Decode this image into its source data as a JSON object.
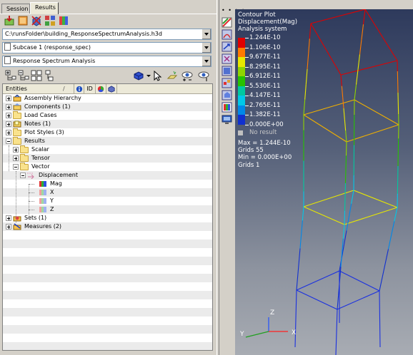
{
  "tabs": [
    {
      "label": "Session",
      "active": false
    },
    {
      "label": "Results",
      "active": true
    }
  ],
  "toolbar1_icons": [
    "load-model-icon",
    "load-results-icon",
    "delete-icon",
    "assembly-icon",
    "multi-results-icon"
  ],
  "file_path": "C:\\runsFolder\\building_ResponseSpectrumAnalysis.h3d",
  "subcase": "Subcase 1 (response_spec)",
  "analysis": "Response Spectrum Analysis",
  "toolbar2_icons": [
    "expand-tree-icon",
    "collapse-tree-icon",
    "filter-icon",
    "tree-options-icon"
  ],
  "toolbar2_right_icons": [
    "display-cube-icon",
    "select-arrow-icon",
    "isolate-icon",
    "show-hide-icon",
    "show-one-icon"
  ],
  "tree_header": {
    "entities": "Entities",
    "id_label": "ID"
  },
  "tree": [
    {
      "label": "Assembly Hierarchy",
      "icon": "assembly",
      "level": 0,
      "expander": "plus"
    },
    {
      "label": "Components (1)",
      "icon": "component",
      "level": 0,
      "expander": "plus"
    },
    {
      "label": "Load Cases",
      "icon": "folder",
      "level": 0,
      "expander": "plus"
    },
    {
      "label": "Notes (1)",
      "icon": "note",
      "level": 0,
      "expander": "plus"
    },
    {
      "label": "Plot Styles (3)",
      "icon": "folder",
      "level": 0,
      "expander": "plus"
    },
    {
      "label": "Results",
      "icon": "folder",
      "level": 0,
      "expander": "minus"
    },
    {
      "label": "Scalar",
      "icon": "folder",
      "level": 1,
      "expander": "plus"
    },
    {
      "label": "Tensor",
      "icon": "folder",
      "level": 1,
      "expander": "plus"
    },
    {
      "label": "Vector",
      "icon": "folder",
      "level": 1,
      "expander": "minus"
    },
    {
      "label": "Displacement",
      "icon": "vector",
      "level": 2,
      "expander": "minus"
    },
    {
      "label": "Mag",
      "icon": "mag-active",
      "level": 3,
      "expander": "none"
    },
    {
      "label": "X",
      "icon": "comp",
      "level": 3,
      "expander": "none"
    },
    {
      "label": "Y",
      "icon": "comp",
      "level": 3,
      "expander": "none"
    },
    {
      "label": "Z",
      "icon": "comp",
      "level": 3,
      "expander": "none"
    },
    {
      "label": "Sets  (1)",
      "icon": "sets",
      "level": 0,
      "expander": "plus"
    },
    {
      "label": "Measures (2)",
      "icon": "measures",
      "level": 0,
      "expander": "plus"
    }
  ],
  "side_icons": [
    "contour-icon",
    "deformed-icon",
    "vector-plot-icon",
    "tensor-plot-icon",
    "iso-icon",
    "markers-icon",
    "query-icon",
    "legend-icon",
    "monitor-icon"
  ],
  "contour": {
    "title": "Contour Plot",
    "result": "Displacement(Mag)",
    "system": "Analysis system",
    "legend_levels": [
      "1.244E-10",
      "1.106E-10",
      "9.677E-11",
      "8.295E-11",
      "6.912E-11",
      "5.530E-11",
      "4.147E-11",
      "2.765E-11",
      "1.382E-11",
      "0.000E+00"
    ],
    "legend_colors": [
      "#e00000",
      "#ff7a00",
      "#e8e800",
      "#8fd400",
      "#27c200",
      "#00c8a0",
      "#00c8e8",
      "#0088e8",
      "#1030d0"
    ],
    "no_result_label": "No result",
    "no_result_color": "#c0c0c0",
    "max_label": "Max = 1.244E-10",
    "max_grid": "Grids 55",
    "min_label": "Min = 0.000E+00",
    "min_grid": "Grids 1"
  },
  "triad": {
    "x": "X",
    "y": "Y",
    "z": "Z"
  }
}
